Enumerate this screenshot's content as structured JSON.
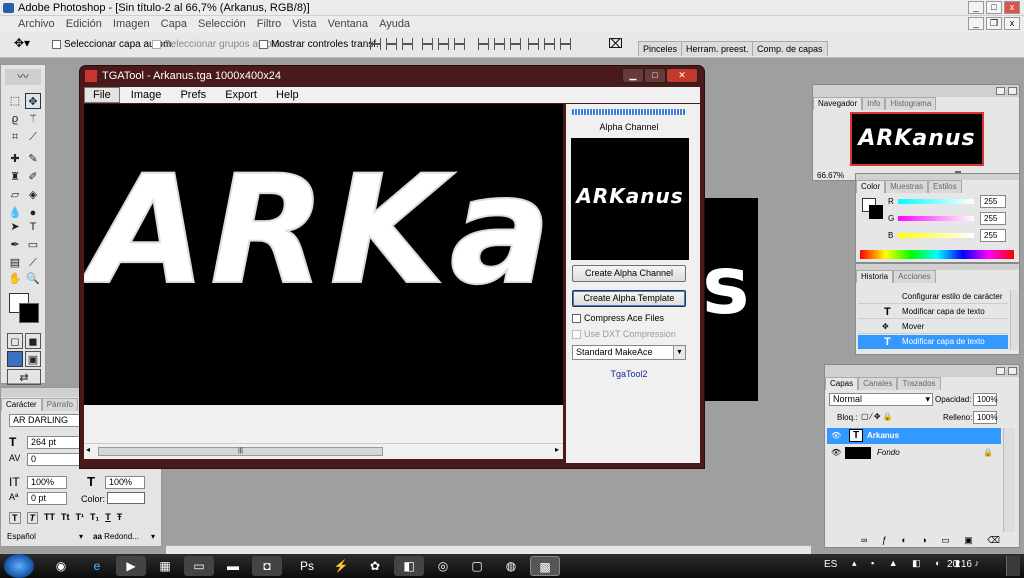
{
  "photoshop": {
    "title": "Adobe Photoshop - [Sin título-2 al 66,7% (Arkanus, RGB/8)]",
    "menu": [
      "Archivo",
      "Edición",
      "Imagen",
      "Capa",
      "Selección",
      "Filtro",
      "Vista",
      "Ventana",
      "Ayuda"
    ],
    "options": {
      "auto_select_layer": "Seleccionar capa autom.",
      "auto_select_groups": "Seleccionar grupos autom.",
      "show_transform": "Mostrar controles transf."
    },
    "wells": [
      "Pinceles",
      "Herram. preest.",
      "Comp. de capas"
    ]
  },
  "tga": {
    "title": "TGATool - Arkanus.tga  1000x400x24",
    "menu": [
      "File",
      "Image",
      "Prefs",
      "Export",
      "Help"
    ],
    "alpha_label": "Alpha Channel",
    "preview_text": "ARKanus",
    "canvas_text": "ARKa",
    "create_alpha": "Create Alpha Channel",
    "create_template": "Create Alpha Template",
    "compress_ace": "Compress Ace Files",
    "use_dxt": "Use DXT Compression",
    "preset": "Standard MakeAce",
    "brand": "TgaTool2"
  },
  "bgdoc_text": "s",
  "character": {
    "tabs": [
      "Carácter",
      "Párrafo"
    ],
    "font": "AR DARLING",
    "size": "264 pt",
    "tracking": "0",
    "vscale": "100%",
    "hscale": "100%",
    "baseline": "0 pt",
    "color_label": "Color:",
    "styles": [
      "T",
      "T",
      "TT",
      "Tt",
      "T¹",
      "T₁",
      "T",
      "Ŧ"
    ],
    "language": "Español",
    "aa": "Redond..."
  },
  "navigator": {
    "tabs": [
      "Navegador",
      "Info",
      "Histograma"
    ],
    "zoom": "66.67%",
    "preview_text": "ARKanus"
  },
  "color": {
    "tabs": [
      "Color",
      "Muestras",
      "Estilos"
    ],
    "channels": [
      {
        "label": "R",
        "value": "255"
      },
      {
        "label": "G",
        "value": "255"
      },
      {
        "label": "B",
        "value": "255"
      }
    ]
  },
  "history": {
    "tabs": [
      "Historia",
      "Acciones"
    ],
    "items": [
      "Configurar estilo de carácter",
      "Modificar capa de texto",
      "Mover",
      "Modificar capa de texto"
    ]
  },
  "layers": {
    "tabs": [
      "Capas",
      "Canales",
      "Trazados"
    ],
    "blend": "Normal",
    "opacity_label": "Opacidad:",
    "opacity": "100%",
    "lock_label": "Bloq.:",
    "fill_label": "Relleno:",
    "fill": "100%",
    "items": [
      {
        "name": "Arkanus"
      },
      {
        "name": "Fondo"
      }
    ]
  },
  "taskbar": {
    "lang": "ES",
    "time": "20:16"
  }
}
